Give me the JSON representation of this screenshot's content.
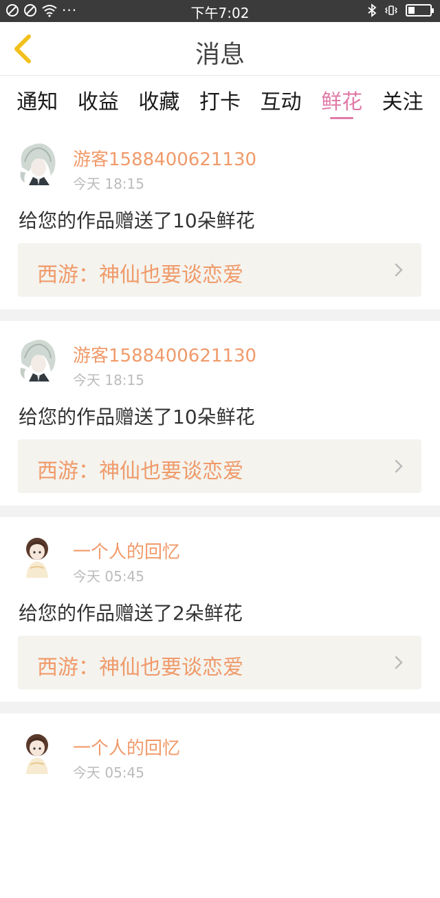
{
  "status_bar": {
    "time": "下午7:02",
    "left_icons": [
      "blocked-icon",
      "blocked-icon",
      "wifi-icon"
    ],
    "more": "···",
    "right_icons": [
      "bluetooth-icon",
      "vibrate-icon",
      "battery-icon"
    ]
  },
  "header": {
    "title": "消息",
    "back_icon": "chevron-left-icon",
    "accent": "#f2c01b"
  },
  "tabs": [
    {
      "label": "通知"
    },
    {
      "label": "收益"
    },
    {
      "label": "收藏"
    },
    {
      "label": "打卡"
    },
    {
      "label": "互动"
    },
    {
      "label": "鲜花",
      "active": true
    },
    {
      "label": "关注"
    }
  ],
  "colors": {
    "active_tab": "#e079a7",
    "username": "#f09a6a",
    "link_bg": "#f4f3ee"
  },
  "messages": [
    {
      "avatar": "avatar-silver-hair",
      "username": "游客1588400621130",
      "time": "今天 18:15",
      "text": "给您的作品赠送了10朵鲜花",
      "work_title": "西游：神仙也要谈恋爱"
    },
    {
      "avatar": "avatar-silver-hair",
      "username": "游客1588400621130",
      "time": "今天 18:15",
      "text": "给您的作品赠送了10朵鲜花",
      "work_title": "西游：神仙也要谈恋爱"
    },
    {
      "avatar": "avatar-girl",
      "username": "一个人的回忆",
      "time": "今天 05:45",
      "text": "给您的作品赠送了2朵鲜花",
      "work_title": "西游：神仙也要谈恋爱"
    },
    {
      "avatar": "avatar-girl",
      "username": "一个人的回忆",
      "time": "今天 05:45"
    }
  ]
}
